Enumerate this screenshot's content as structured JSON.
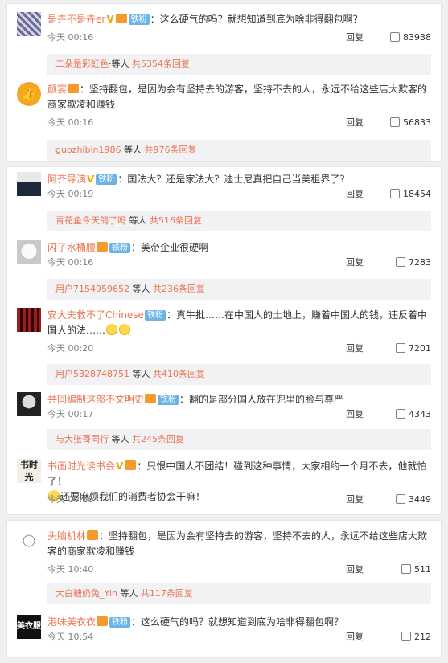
{
  "panel1": {
    "comments": [
      {
        "user": "是卉不是卉er",
        "sep": "：",
        "text": "这么硬气的吗？就想知道到底为啥非得翻包啊？",
        "time": "今天 00:16",
        "reply": "回复",
        "likes": "83938",
        "sub_user": "二朵是彩虹色",
        "sub_mid": "·等人 ",
        "sub_count": "共5354条回复",
        "avatar": "pattern"
      },
      {
        "user": "颜宴",
        "sep": "：",
        "text": "坚持翻包，是因为会有坚持去的游客，坚持不去的人，永远不给这些店大欺客的商家欺凌和赚钱",
        "time": "今天 00:16",
        "reply": "回复",
        "likes": "56833",
        "sub_user": "guozhibin1986",
        "sub_mid": " 等人 ",
        "sub_count": "共976条回复",
        "avatar": "thumb-icon"
      }
    ]
  },
  "panel2": {
    "comments": [
      {
        "user": "阿齐导演",
        "sep": "：",
        "text": "国法大？还是家法大？迪士尼真把自己当美租界了？",
        "time": "今天 00:19",
        "reply": "回复",
        "likes": "18454",
        "sub_user": "青花鱼今天鸽了吗",
        "sub_mid": " 等人 ",
        "sub_count": "共516条回复"
      },
      {
        "user": "闪了水桶腰",
        "sep": "：",
        "text": "美帝企业很硬啊",
        "time": "今天 00:16",
        "reply": "回复",
        "likes": "7283",
        "sub_user": "用户7154959652",
        "sub_mid": " 等人 ",
        "sub_count": "共236条回复"
      },
      {
        "user": "安大夫救不了Chinese",
        "sep": "：",
        "text": "真牛批……在中国人的土地上，赚着中国人的钱，违反着中国人的法……",
        "time": "今天 00:20",
        "reply": "回复",
        "likes": "7201",
        "sub_user": "用户5328748751",
        "sub_mid": " 等人 ",
        "sub_count": "共410条回复"
      },
      {
        "user": "共同编制这部不文明史",
        "sep": "：",
        "text": "翻的是部分国人放在兜里的脸与尊严",
        "time": "今天 00:17",
        "reply": "回复",
        "likes": "4343",
        "sub_user": "与大张哥同行",
        "sub_mid": " 等人 ",
        "sub_count": "共245条回复"
      },
      {
        "user": "书画时光读书会",
        "sep": "：",
        "text": "只恨中国人不团结！碰到这种事情，大家相约一个月不去，他就怕了！",
        "text2": "还要麻烦我们的消费者协会干嘛！",
        "time": "今天 00:18",
        "reply": "回复",
        "likes": "3449",
        "avatar_text": "书时光"
      }
    ]
  },
  "panel3": {
    "comments": [
      {
        "user": "头脑机林",
        "sep": "：",
        "text": "坚持翻包，是因为会有坚持去的游客，坚持不去的人，永远不给这些店大欺客的商家欺凌和赚钱",
        "time": "今天 10:40",
        "reply": "回复",
        "likes": "511",
        "sub_user": "大白糖奶兔_Yin",
        "sub_mid": " 等人 ",
        "sub_count": "共117条回复"
      },
      {
        "user": "港味美衣衣",
        "sep": "：",
        "text": "这么硬气的吗？就想知道到底为啥非得翻包啊？",
        "time": "今天 10:54",
        "reply": "回复",
        "likes": "212",
        "avatar_text": "美衣服"
      }
    ]
  },
  "badges": {
    "v": "V",
    "fan": "铁粉"
  },
  "colors": {
    "username": "#eb7350",
    "fan_badge": "#6bb4e8",
    "v_badge": "#f6a500"
  }
}
